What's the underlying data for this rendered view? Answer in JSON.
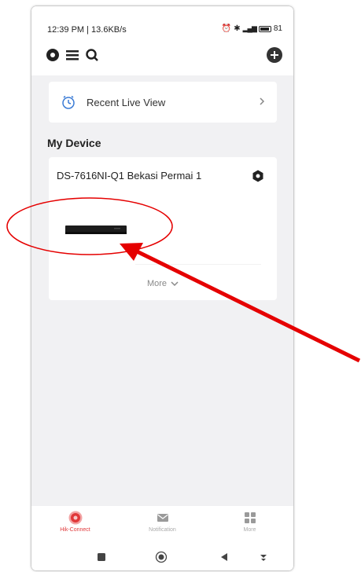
{
  "status_bar": {
    "time": "12:39 PM | 13.6KB/s",
    "battery": "81"
  },
  "toolbar": {
    "icons": [
      "record-icon",
      "list-icon",
      "search-icon",
      "add-icon"
    ]
  },
  "recent_live_view": {
    "label": "Recent Live View"
  },
  "section": {
    "title": "My Device"
  },
  "device": {
    "name": "DS-7616NI-Q1 Bekasi Permai 1",
    "more_label": "More"
  },
  "tabs": [
    {
      "label": "Hik-Connect",
      "icon": "hik-connect-icon",
      "active": true
    },
    {
      "label": "Notification",
      "icon": "envelope-icon",
      "active": false
    },
    {
      "label": "More",
      "icon": "grid-icon",
      "active": false
    }
  ],
  "colors": {
    "accent": "#e0383a",
    "annotation": "#e50000"
  }
}
